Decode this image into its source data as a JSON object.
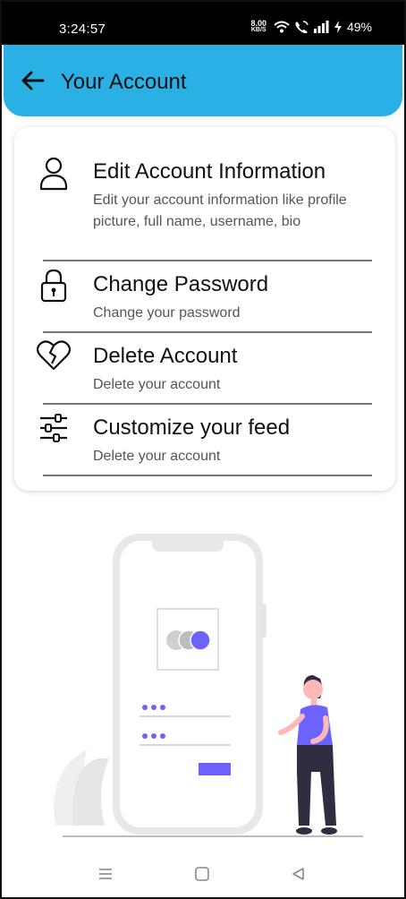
{
  "status_bar": {
    "time": "3:24:57",
    "speed_value": "8.00",
    "speed_unit": "KB/S",
    "battery": "49%"
  },
  "header": {
    "title": "Your Account",
    "back_icon": "arrow-left-icon"
  },
  "menu": {
    "items": [
      {
        "icon": "user-icon",
        "title": "Edit Account Information",
        "description": "Edit your account information like profile picture, full name, username, bio"
      },
      {
        "icon": "lock-icon",
        "title": "Change Password",
        "description": "Change your password"
      },
      {
        "icon": "broken-heart-icon",
        "title": "Delete Account",
        "description": "Delete your account"
      },
      {
        "icon": "sliders-icon",
        "title": "Customize your feed",
        "description": "Delete your account"
      }
    ]
  },
  "illustration": {
    "name": "phone-login-illustration",
    "password_dots": "•••",
    "accent_color": "#6c63ff"
  },
  "nav_bar": {
    "recents_icon": "menu-icon",
    "home_icon": "square-icon",
    "back_icon": "triangle-back-icon"
  },
  "colors": {
    "header_bg": "#2ab0e4",
    "accent": "#6c63ff"
  }
}
